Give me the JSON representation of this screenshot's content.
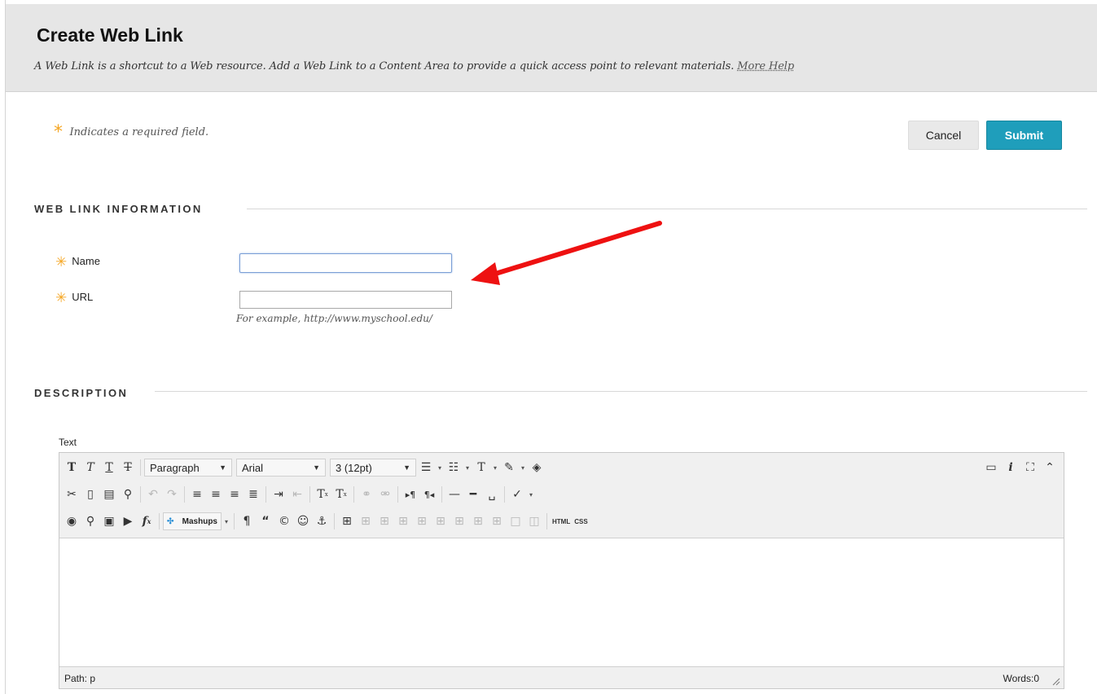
{
  "page": {
    "title": "Create Web Link",
    "description": "A Web Link is a shortcut to a Web resource. Add a Web Link to a Content Area to provide a quick access point to relevant materials.",
    "help_link": "More Help"
  },
  "required_note": {
    "star": "*",
    "text": "Indicates a required field."
  },
  "actions": {
    "cancel_label": "Cancel",
    "submit_label": "Submit"
  },
  "web_link_section": {
    "title": "WEB LINK INFORMATION",
    "fields": {
      "name": {
        "label": "Name",
        "required": true,
        "value": ""
      },
      "url": {
        "label": "URL",
        "required": true,
        "value": "",
        "hint": "For example, http://www.myschool.edu/"
      }
    }
  },
  "description_section": {
    "title": "DESCRIPTION",
    "editor": {
      "label": "Text",
      "format_select": "Paragraph",
      "font_select": "Arial",
      "size_select": "3 (12pt)",
      "mashups_label": "Mashups",
      "html_label": "HTML",
      "css_label": "CSS",
      "status_path": "Path: p",
      "word_count": "Words:0"
    }
  },
  "annotation": {
    "arrow_color": "#ee1111"
  },
  "colors": {
    "accent": "#1f9ebb",
    "required": "#f5a623",
    "header_bg": "#e6e6e6"
  }
}
